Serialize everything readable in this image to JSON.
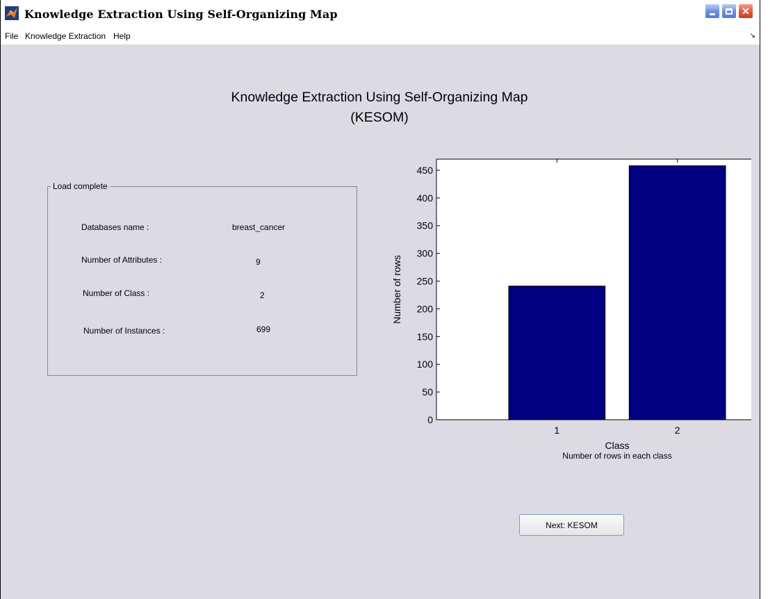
{
  "window": {
    "title": "Knowledge Extraction Using Self-Organizing Map"
  },
  "menu": {
    "items": [
      "File",
      "Knowledge Extraction",
      "Help"
    ],
    "dock_arrow": "↘"
  },
  "heading": {
    "line1": "Knowledge Extraction Using Self-Organizing Map",
    "line2": "(KESOM)"
  },
  "group": {
    "title": "Load complete",
    "rows": [
      {
        "label": "Databases name :",
        "value": "breast_cancer"
      },
      {
        "label": "Number of Attributes :",
        "value": "9"
      },
      {
        "label": "Number of Class :",
        "value": "2"
      },
      {
        "label": "Number of Instances :",
        "value": "699"
      }
    ]
  },
  "chart_data": {
    "type": "bar",
    "categories": [
      "1",
      "2"
    ],
    "values": [
      241,
      458
    ],
    "title": "",
    "xlabel": "Class",
    "subtitle": "Number of rows in each class",
    "ylabel": "Number of rows",
    "ylim": [
      0,
      470
    ],
    "yticks": [
      0,
      50,
      100,
      150,
      200,
      250,
      300,
      350,
      400,
      450
    ],
    "bar_color": "#000080",
    "grid": false
  },
  "buttons": {
    "next_label": "Next: KESOM"
  }
}
